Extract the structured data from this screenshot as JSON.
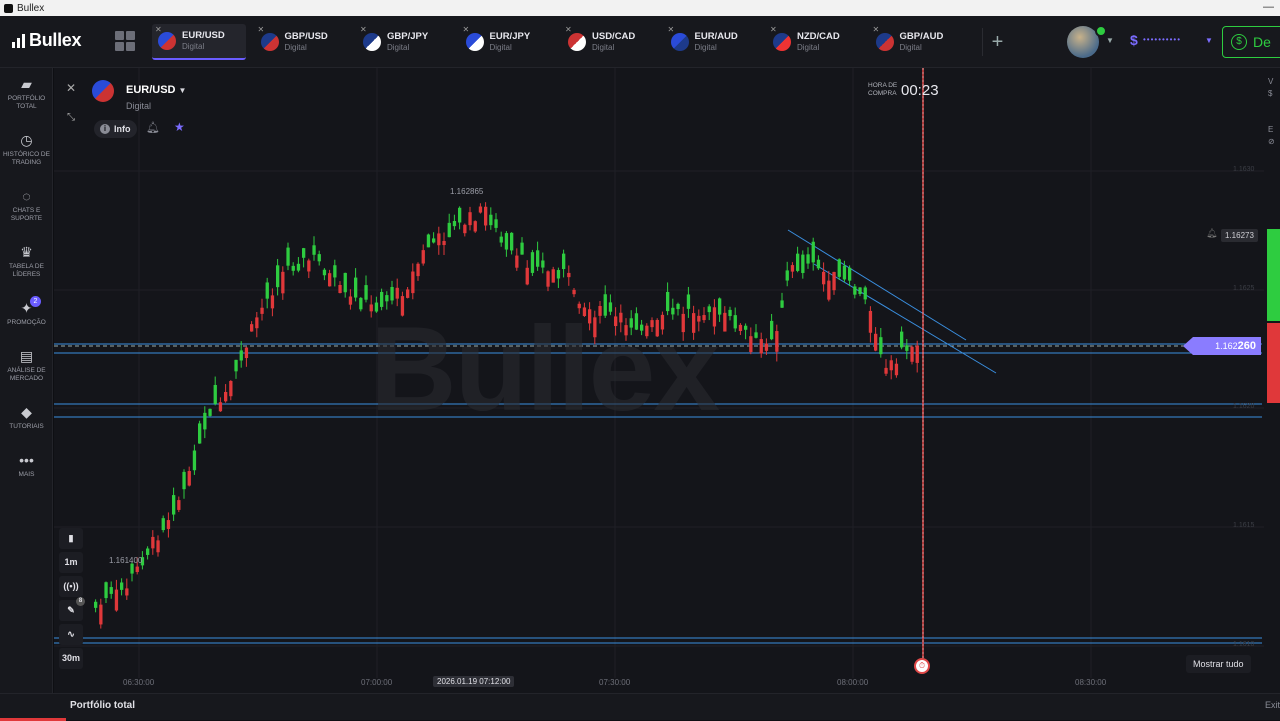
{
  "window": {
    "title": "Bullex"
  },
  "topbar": {
    "logo": "Bullex",
    "tabs": [
      {
        "pair": "EUR/USD",
        "kind": "Digital",
        "active": true,
        "flag": "eu-us"
      },
      {
        "pair": "GBP/USD",
        "kind": "Digital",
        "active": false,
        "flag": "gb-us"
      },
      {
        "pair": "GBP/JPY",
        "kind": "Digital",
        "active": false,
        "flag": "gb-jp"
      },
      {
        "pair": "EUR/JPY",
        "kind": "Digital",
        "active": false,
        "flag": "eu-jp"
      },
      {
        "pair": "USD/CAD",
        "kind": "Digital",
        "active": false,
        "flag": "us-ca"
      },
      {
        "pair": "EUR/AUD",
        "kind": "Digital",
        "active": false,
        "flag": "eu-au"
      },
      {
        "pair": "NZD/CAD",
        "kind": "Digital",
        "active": false,
        "flag": "nz-ca"
      },
      {
        "pair": "GBP/AUD",
        "kind": "Digital",
        "active": false,
        "flag": "gb-au"
      }
    ],
    "add_tab": "+",
    "balance_symbol": "$",
    "balance_mask": "••••••••••",
    "deposit_label": "De"
  },
  "sidebar": {
    "items": [
      {
        "label": "Portfólio total",
        "icon": "briefcase-icon",
        "glyph": "▰"
      },
      {
        "label": "Histórico de trading",
        "icon": "history-icon",
        "glyph": "◷"
      },
      {
        "label": "Chats e suporte",
        "icon": "chat-icon",
        "glyph": "◌"
      },
      {
        "label": "Tabela de líderes",
        "icon": "trophy-icon",
        "glyph": "♛"
      },
      {
        "label": "Promoção",
        "icon": "promo-icon",
        "glyph": "✦",
        "badge": "2"
      },
      {
        "label": "Análise de mercado",
        "icon": "analysis-icon",
        "glyph": "▤"
      },
      {
        "label": "Tutoriais",
        "icon": "graduation-icon",
        "glyph": "◆"
      },
      {
        "label": "Mais",
        "icon": "more-icon",
        "glyph": "•••"
      }
    ]
  },
  "asset": {
    "name": "EUR/USD",
    "type": "Digital",
    "info_label": "Info",
    "info_glyph": "i"
  },
  "chart": {
    "purchase_label_line1": "HORA DE",
    "purchase_label_line2": "COMPRA",
    "purchase_time": "00:23",
    "current_price_prefix": "1.162",
    "current_price_suffix": "260",
    "alert_price": "1.16273",
    "high_label": "1.162865",
    "low_label": "1.161400",
    "show_all_label": "Mostrar tudo",
    "watermark": "Bullex",
    "x_labels": [
      "06:30:00",
      "07:00:00",
      "2026.01.19 07:12:00",
      "07:30:00",
      "08:00:00",
      "08:30:00"
    ],
    "y_labels": [
      "1.1630",
      "1.1625",
      "1.1620",
      "1.1615",
      "1.1610"
    ],
    "tools": [
      "1m",
      "30m"
    ],
    "tool_badge": "8",
    "colors": {
      "up": "#2ecc40",
      "down": "#e0383a",
      "accent": "#7b6cff",
      "levels": "#3a8fe0"
    }
  },
  "footer": {
    "portfolio_label": "Portfólio total",
    "exit_label": "Exit"
  }
}
